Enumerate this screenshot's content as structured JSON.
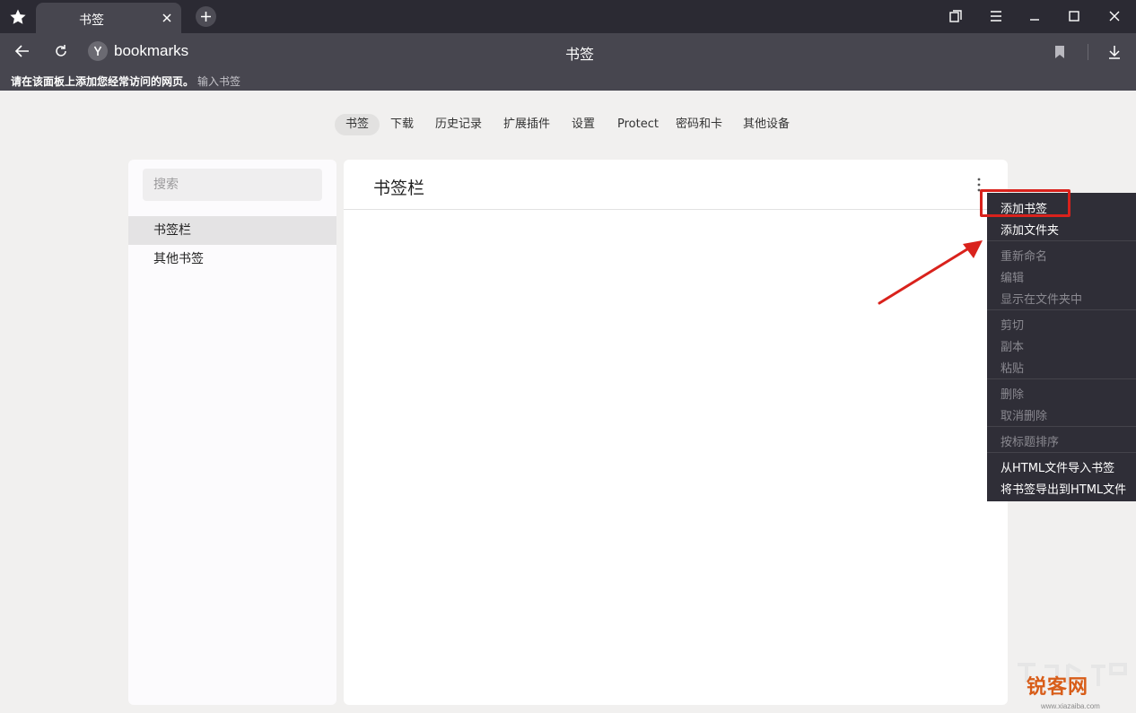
{
  "tab": {
    "title": "书签"
  },
  "toolbar": {
    "address": "bookmarks",
    "page_title": "书签"
  },
  "bookmarks_bar": {
    "hint": "请在该面板上添加您经常访问的网页。",
    "sub": "输入书签"
  },
  "nav_tabs": [
    "书签",
    "下载",
    "历史记录",
    "扩展插件",
    "设置",
    "Protect",
    "密码和卡",
    "其他设备"
  ],
  "sidebar": {
    "search_placeholder": "搜索",
    "folders": [
      "书签栏",
      "其他书签"
    ]
  },
  "main": {
    "title": "书签栏"
  },
  "context_menu": {
    "items": [
      {
        "label": "添加书签",
        "enabled": true
      },
      {
        "label": "添加文件夹",
        "enabled": true
      },
      {
        "label": "重新命名",
        "enabled": false
      },
      {
        "label": "编辑",
        "enabled": false
      },
      {
        "label": "显示在文件夹中",
        "enabled": false
      },
      {
        "label": "剪切",
        "enabled": false
      },
      {
        "label": "副本",
        "enabled": false
      },
      {
        "label": "粘贴",
        "enabled": false
      },
      {
        "label": "删除",
        "enabled": false
      },
      {
        "label": "取消删除",
        "enabled": false
      },
      {
        "label": "按标题排序",
        "enabled": false
      },
      {
        "label": "从HTML文件导入书签",
        "enabled": true
      },
      {
        "label": "将书签导出到HTML文件",
        "enabled": true
      }
    ]
  },
  "watermark": {
    "logo": "锐客网",
    "url": "www.xiazaiba.com"
  },
  "colors": {
    "titlebar": "#2b2a33",
    "toolbar": "#47464f",
    "menu": "#2f2e37",
    "highlight": "#d9221c",
    "page_bg": "#f1f0ef"
  }
}
